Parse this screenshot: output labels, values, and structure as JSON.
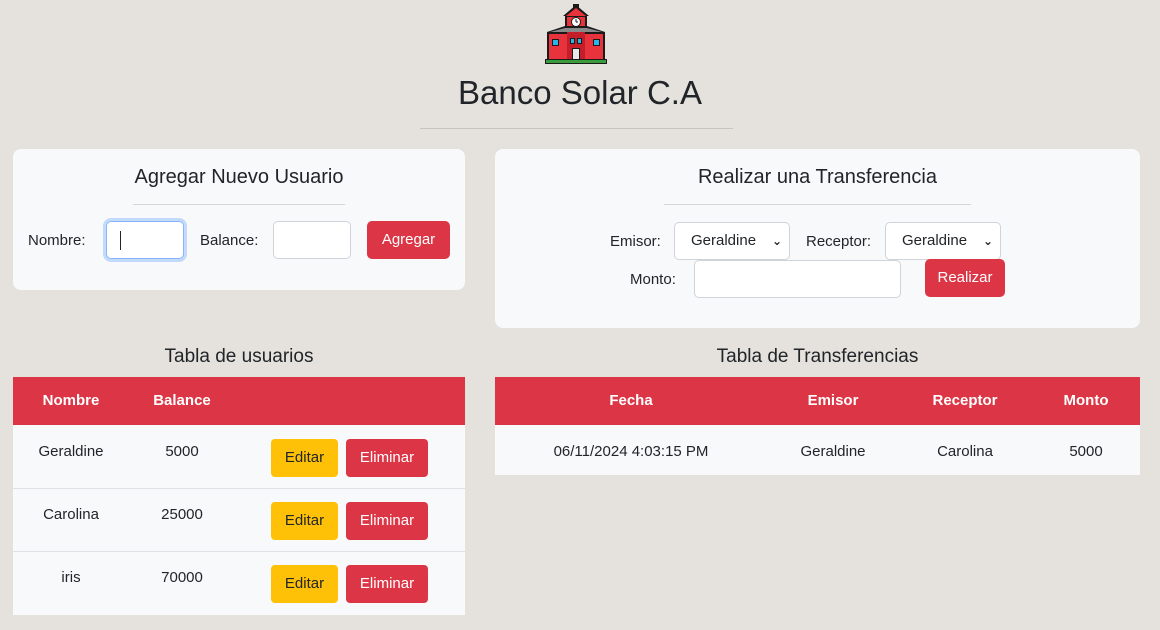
{
  "header": {
    "logo_icon": "school-building-icon",
    "title": "Banco Solar C.A"
  },
  "add_user": {
    "title": "Agregar Nuevo Usuario",
    "name_label": "Nombre:",
    "name_value": "",
    "balance_label": "Balance:",
    "balance_value": "",
    "submit_label": "Agregar"
  },
  "transfer": {
    "title": "Realizar una Transferencia",
    "sender_label": "Emisor:",
    "sender_selected": "Geraldine",
    "receiver_label": "Receptor:",
    "receiver_selected": "Geraldine",
    "amount_label": "Monto:",
    "amount_value": "",
    "submit_label": "Realizar"
  },
  "users_table": {
    "title": "Tabla de usuarios",
    "columns": [
      "Nombre",
      "Balance"
    ],
    "edit_label": "Editar",
    "delete_label": "Eliminar",
    "rows": [
      {
        "name": "Geraldine",
        "balance": "5000"
      },
      {
        "name": "Carolina",
        "balance": "25000"
      },
      {
        "name": "iris",
        "balance": "70000"
      }
    ]
  },
  "transfers_table": {
    "title": "Tabla de Transferencias",
    "columns": [
      "Fecha",
      "Emisor",
      "Receptor",
      "Monto"
    ],
    "rows": [
      {
        "date": "06/11/2024 4:03:15 PM",
        "sender": "Geraldine",
        "receiver": "Carolina",
        "amount": "5000"
      }
    ]
  },
  "colors": {
    "background": "#e5e2dd",
    "accent_red": "#dc3545",
    "edit_yellow": "#ffc107",
    "card": "#f8f9fa"
  }
}
